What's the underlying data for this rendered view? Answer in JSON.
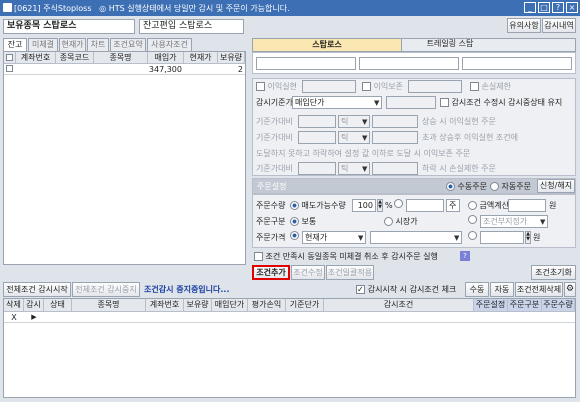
{
  "window": {
    "title": "[0621] 주식Stoploss",
    "notice": "HTS 실행상태에서 당일만 감시 및 주문이 가능합니다."
  },
  "header": {
    "title": "보유종목 스탑로스",
    "sub_title": "잔고편입 스탑로스",
    "notice_btn": "유의사항",
    "guide_btn": "감시내역"
  },
  "left_tabs": [
    "잔고",
    "미체결",
    "현재가",
    "차트",
    "조건요약",
    "사용자조건"
  ],
  "holdings": {
    "columns": [
      "계좌번호",
      "종목코드",
      "종목명",
      "매입가",
      "현재가",
      "보유량"
    ],
    "total_buy": "347,300",
    "total_qty": "2"
  },
  "right_tabs": {
    "active": "스탑로스",
    "other": "트레일링 스탑"
  },
  "cond": {
    "profit_label": "이익실현",
    "profit2_label": "이익보존",
    "loss_label": "손실제한",
    "basis_label": "감시기준가",
    "basis_value": "매입단가",
    "auto_label": "감시조건 수정시 감시중상태 유지",
    "row1_label": "기준가대비",
    "row1_unit": "틱",
    "row1_text": "상승 시  이익실현  주문",
    "row2_label": "기준가대비",
    "row2_unit": "틱",
    "row2_text": "초과 상승후 이익실현 조건에",
    "row3_text": "도달하지 못하고 하락하여 설정 값 이하로 도달 시  이익보존 주문",
    "row4_label": "기준가대비",
    "row4_unit": "틱",
    "row4_text": "하락 시 손실제한 주문"
  },
  "order": {
    "settings_label": "주문설정",
    "auto_order": "수동주문",
    "auto_order2": "자동주문",
    "apply_btn": "신청/해지",
    "qty_label": "주문수량",
    "qty_opt": "매도가능수량",
    "qty_value": "100",
    "pct": "%",
    "qty_unit": "주",
    "amt_label": "금액계산",
    "amt_unit": "원",
    "type_label": "주문구분",
    "type1": "보통",
    "type2": "시장가",
    "cond_type": "조건부지정가",
    "price_label": "주문가격",
    "price_value": "현재가",
    "price_unit": "원"
  },
  "cancel_cond": "조건 만족시 동일종목 미체결 취소 후 감시주문 실행",
  "buttons": {
    "add": "조건추가",
    "edit": "조건수정",
    "batch": "조건일괄적용",
    "reset": "조건초기화"
  },
  "bottom_bar": {
    "start_all": "전체조건 감시시작",
    "stop_all": "전체조건 감시중지",
    "status": "조건감시 중지중입니다...",
    "check_label": "감시시작 시 감시조건 체크",
    "manual": "수동",
    "auto": "자동",
    "delete_all": "조건전체삭제"
  },
  "bottom_cols": [
    "삭제",
    "감시",
    "상태",
    "종목명",
    "계좌번호",
    "보유량",
    "매입단가",
    "평가손익",
    "기준단가",
    "감시조건",
    "주문설정",
    "주문구분",
    "주문수량"
  ],
  "bottom_row": {
    "del": "X",
    "watch": "▶"
  }
}
